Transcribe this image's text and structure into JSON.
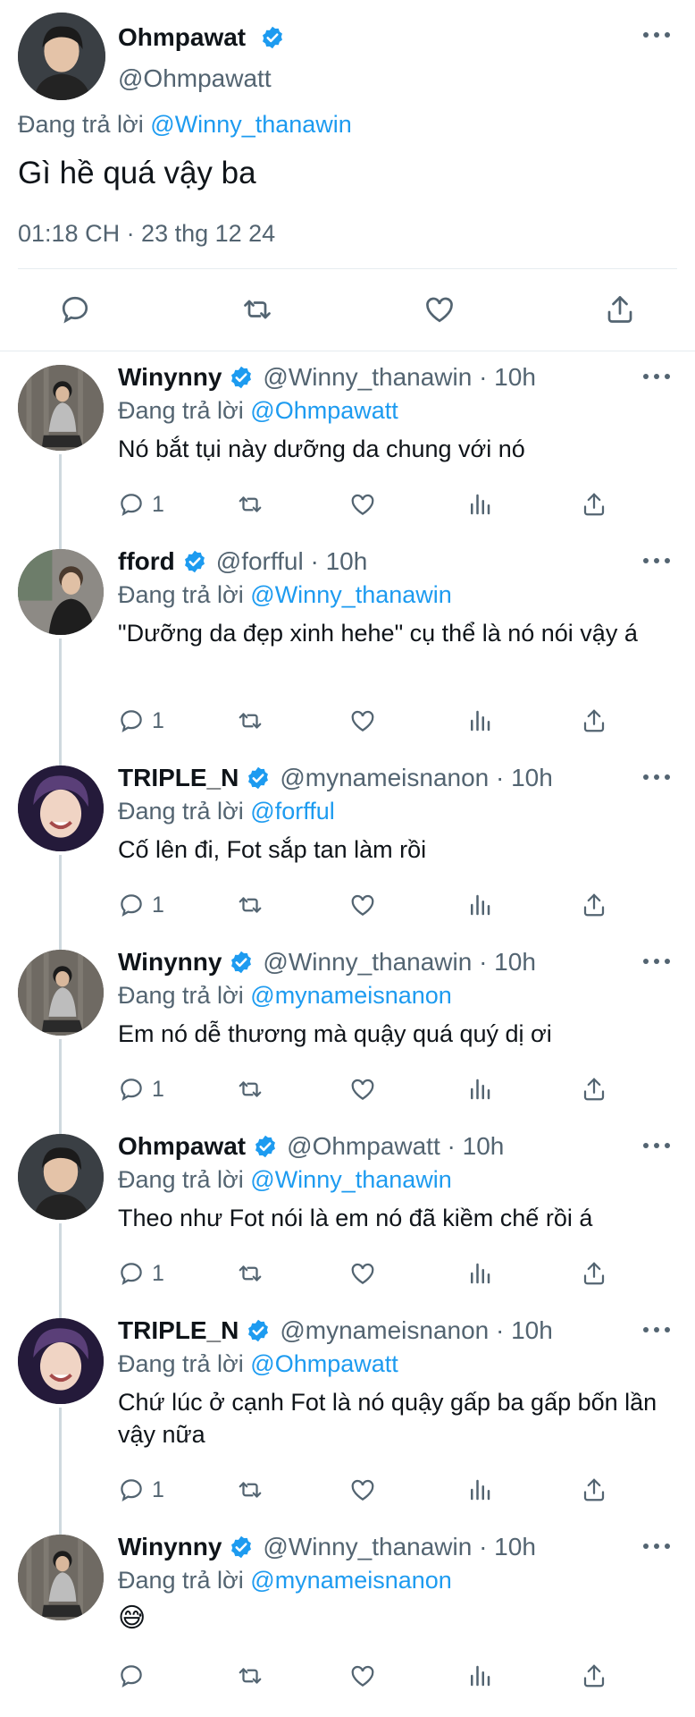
{
  "main_tweet": {
    "name": "Ohmpawat",
    "handle": "@Ohmpawatt",
    "reply_prefix": "Đang trả lời",
    "reply_to": "@Winny_thanawin",
    "text": "Gì hề quá vậy ba",
    "timestamp": "01:18 CH · 23 thg 12 24"
  },
  "replies": [
    {
      "name": "Winynny",
      "handle": "@Winny_thanawin · 10h",
      "reply_prefix": "Đang trả lời",
      "reply_to": "@Ohmpawatt",
      "text": "Nó bắt tụi này dưỡng da chung với nó",
      "reply_count": "1"
    },
    {
      "name": "fford",
      "handle": "@forfful · 10h",
      "reply_prefix": "Đang trả lời",
      "reply_to": "@Winny_thanawin",
      "text": "\"Dưỡng da đẹp xinh hehe\" cụ thể là nó nói vậy á",
      "reply_count": "1"
    },
    {
      "name": "TRIPLE_N",
      "handle": "@mynameisnanon · 10h",
      "reply_prefix": "Đang trả lời",
      "reply_to": "@forfful",
      "text": "Cố lên đi, Fot sắp tan làm rồi",
      "reply_count": "1"
    },
    {
      "name": "Winynny",
      "handle": "@Winny_thanawin · 10h",
      "reply_prefix": "Đang trả lời",
      "reply_to": "@mynameisnanon",
      "text": "Em nó dễ thương mà quậy quá quý dị ơi",
      "reply_count": "1"
    },
    {
      "name": "Ohmpawat",
      "handle": "@Ohmpawatt · 10h",
      "reply_prefix": "Đang trả lời",
      "reply_to": "@Winny_thanawin",
      "text": "Theo như Fot nói là em nó đã kiềm chế rồi á",
      "reply_count": "1"
    },
    {
      "name": "TRIPLE_N",
      "handle": "@mynameisnanon · 10h",
      "reply_prefix": "Đang trả lời",
      "reply_to": "@Ohmpawatt",
      "text": "Chứ lúc ở cạnh Fot là nó quậy gấp ba gấp bốn lần vậy nữa",
      "reply_count": "1"
    },
    {
      "name": "Winynny",
      "handle": "@Winny_thanawin · 10h",
      "reply_prefix": "Đang trả lời",
      "reply_to": "@mynameisnanon",
      "text": "😅",
      "reply_count": ""
    }
  ],
  "icons": {
    "reply": "reply-icon",
    "retweet": "retweet-icon",
    "like": "heart-icon",
    "share": "share-icon",
    "analytics": "analytics-icon",
    "more": "more-icon",
    "verified": "verified-badge-icon"
  },
  "colors": {
    "accent": "#1d9bf0",
    "secondary_text": "#536471",
    "text": "#0f1419",
    "divider": "#e6ecf0"
  }
}
